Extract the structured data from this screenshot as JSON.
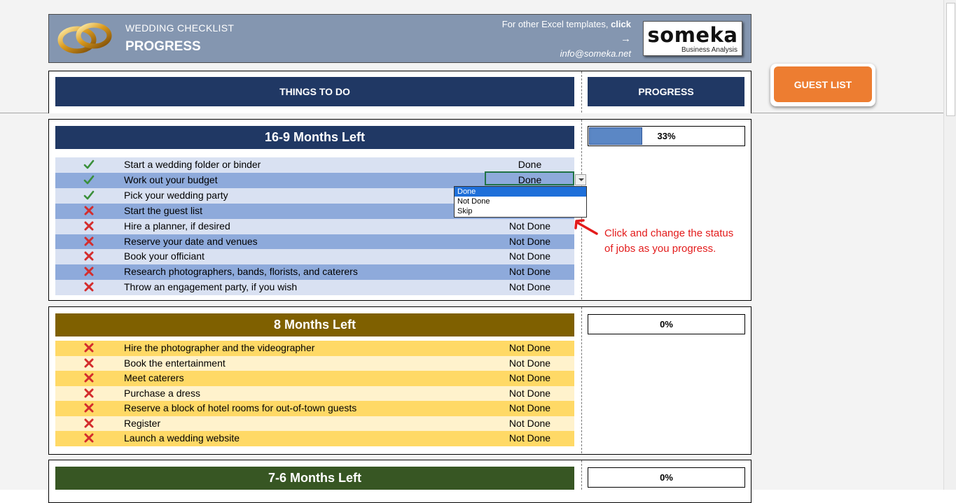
{
  "banner": {
    "subtitle": "WEDDING CHECKLIST",
    "title": "PROGRESS",
    "link_text": "For other Excel templates,",
    "link_bold": "click",
    "arrow": "→",
    "email": "info@someka.net",
    "logo_main": "someka",
    "logo_sub": "Business Analysis"
  },
  "headers": {
    "things": "THINGS TO DO",
    "progress": "PROGRESS"
  },
  "guest_list_button": "GUEST LIST",
  "colors": {
    "navy": "#203864",
    "olive": "#7f6000",
    "green": "#375623",
    "check": "#3a8f3a",
    "cross": "#d42d2d"
  },
  "sections": [
    {
      "title": "16-9 Months Left",
      "progress": "33%",
      "progress_value": 0.33,
      "tasks": [
        {
          "icon": "check-icon",
          "task": "Start a wedding folder or binder",
          "status": "Done"
        },
        {
          "icon": "check-icon",
          "task": "Work out your budget",
          "status": "Done"
        },
        {
          "icon": "check-icon",
          "task": "Pick your wedding party",
          "status": ""
        },
        {
          "icon": "cross-icon",
          "task": "Start the guest list",
          "status": ""
        },
        {
          "icon": "cross-icon",
          "task": "Hire a planner, if desired",
          "status": "Not Done"
        },
        {
          "icon": "cross-icon",
          "task": "Reserve your date and venues",
          "status": "Not Done"
        },
        {
          "icon": "cross-icon",
          "task": "Book your officiant",
          "status": "Not Done"
        },
        {
          "icon": "cross-icon",
          "task": "Research photographers, bands, florists, and caterers",
          "status": "Not Done"
        },
        {
          "icon": "cross-icon",
          "task": "Throw an engagement party, if you wish",
          "status": "Not Done"
        }
      ]
    },
    {
      "title": "8 Months Left",
      "progress": "0%",
      "progress_value": 0,
      "tasks": [
        {
          "icon": "cross-icon",
          "task": "Hire the photographer and the videographer",
          "status": "Not Done"
        },
        {
          "icon": "cross-icon",
          "task": "Book the entertainment",
          "status": "Not Done"
        },
        {
          "icon": "cross-icon",
          "task": "Meet caterers",
          "status": "Not Done"
        },
        {
          "icon": "cross-icon",
          "task": "Purchase a dress",
          "status": "Not Done"
        },
        {
          "icon": "cross-icon",
          "task": "Reserve a block of hotel rooms for out-of-town guests",
          "status": "Not Done"
        },
        {
          "icon": "cross-icon",
          "task": "Register",
          "status": "Not Done"
        },
        {
          "icon": "cross-icon",
          "task": "Launch a wedding website",
          "status": "Not Done"
        }
      ]
    },
    {
      "title": "7-6 Months Left",
      "progress": "0%",
      "progress_value": 0,
      "tasks": []
    }
  ],
  "dropdown": {
    "options": [
      "Done",
      "Not Done",
      "Skip"
    ],
    "selected": "Done"
  },
  "note": "Click and change the status of jobs as you progress."
}
